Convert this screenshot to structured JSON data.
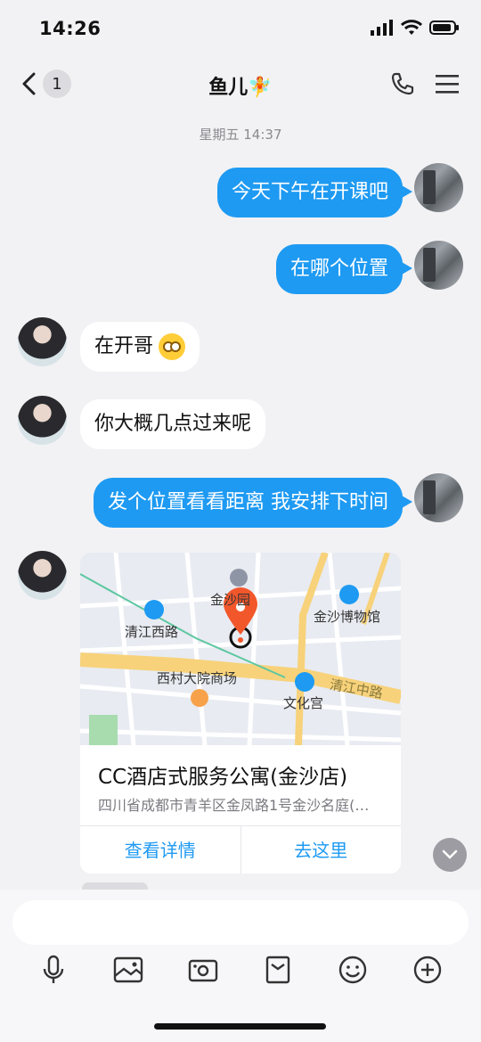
{
  "status": {
    "time": "14:26"
  },
  "nav": {
    "badge_count": "1",
    "title": "鱼儿🧚"
  },
  "timestamp": "星期五 14:37",
  "messages": [
    {
      "from": "me",
      "text": "今天下午在开课吧"
    },
    {
      "from": "me",
      "text": "在哪个位置"
    },
    {
      "from": "them",
      "text": "在开哥"
    },
    {
      "from": "them",
      "text": "你大概几点过来呢"
    },
    {
      "from": "me",
      "text": "发个位置看看距离 我安排下时间"
    }
  ],
  "location": {
    "name": "CC酒店式服务公寓(金沙店)",
    "address": "四川省成都市青羊区金凤路1号金沙名庭(…",
    "view_details": "查看详情",
    "go_here": "去这里",
    "map_labels": {
      "qingjiang_west": "清江西路",
      "jinsha_museum": "金沙博物馆",
      "park": "金沙园",
      "xicun": "西村大院商场",
      "wenhuagong": "文化宫",
      "qingjiang_mid": "清江中路"
    }
  },
  "icons": [
    "chevron-left-icon",
    "phone-icon",
    "menu-icon",
    "chevron-down-icon",
    "microphone-icon",
    "image-icon",
    "camera-icon",
    "sticker-pack-icon",
    "emoji-icon",
    "plus-icon"
  ],
  "colors": {
    "accent": "#1e9af2",
    "pin": "#f2572c"
  }
}
